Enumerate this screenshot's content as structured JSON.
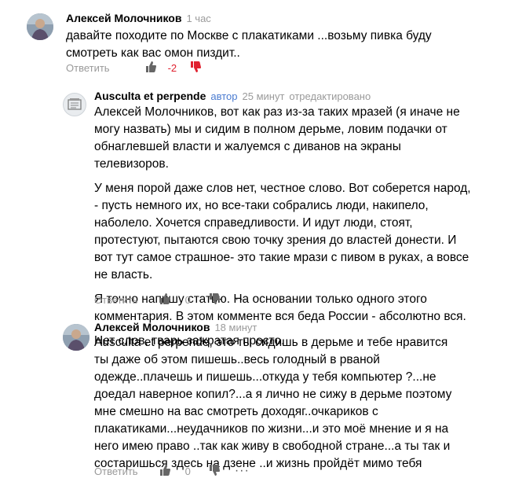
{
  "comments": [
    {
      "author": "Алексей Молочников",
      "time": "1 час",
      "text": [
        "давайте походите по Москве с плакатиками ...возьму пивка буду смотреть как вас омон пиздит.."
      ],
      "reply_label": "Ответить",
      "rating": "-2",
      "more": "···"
    },
    {
      "author": "Auscultа et perpende",
      "badge": "автор",
      "time": "25 минут",
      "edited": "отредактировано",
      "text": [
        "Алексей Молочников, вот как раз из-за таких мразей (я иначе не могу назвать) мы и сидим в полном дерьме, ловим подачки от обнаглевшей власти и жалуемся с диванов на экраны телевизоров.",
        "У меня порой даже слов нет, честное слово. Вот соберется народ, - пусть немного их, но все-таки собрались люди, накипело, наболело. Хочется справедливости. И идут люди, стоят, протестуют, пытаются свою точку зрения до властей донести. И вот тут самое страшное- это такие мрази с пивом в руках, а вовсе не власть.",
        "Я точно напишу статью. На основании только одного этого комментария. В этом комменте вся беда России - абсолютно вся.",
        "Нет слов, тварь зажратая просто."
      ],
      "reply_label": "Ответить",
      "rating": "0",
      "more": "···"
    },
    {
      "author": "Алексей Молочников",
      "time": "18 минут",
      "text": [
        "Auscultа et perpende, это ты сидишь в дерьме и тебе нравится ты даже об этом пишешь..весь голодный в рваной одежде..плачешь и пишешь...откуда у тебя компьютер ?...не доедал наверное копил?...а я лично не сижу в дерьме поэтому мне смешно на вас смотреть доходяг..очкариков с плакатиками...неудачников по жизни...и это моё мнение и я на него имею право ..так как живу в свободной стране...а ты так и состаришься здесь на дзене ..и жизнь пройдёт мимо тебя"
      ],
      "reply_label": "Ответить",
      "rating": "0",
      "more": "···"
    }
  ]
}
